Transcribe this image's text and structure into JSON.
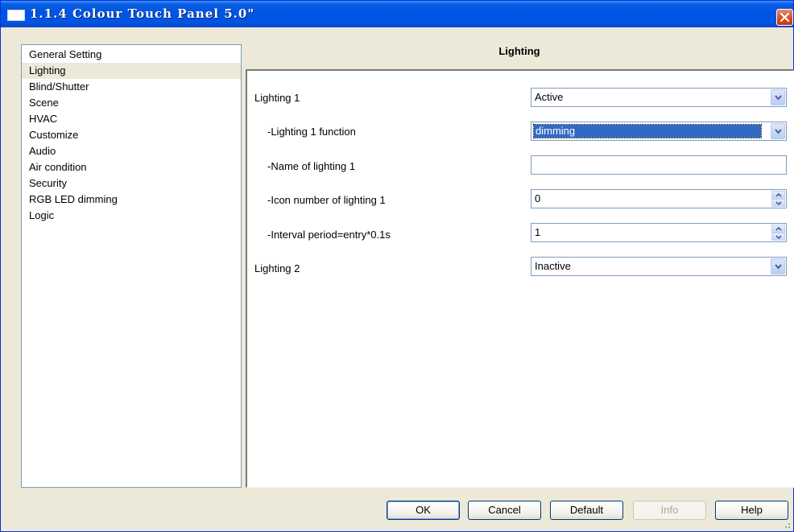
{
  "window": {
    "title": "1.1.4 Colour Touch Panel 5.0\"",
    "close_icon": "close-icon"
  },
  "nav": {
    "items": [
      {
        "label": "General Setting",
        "selected": false
      },
      {
        "label": "Lighting",
        "selected": true
      },
      {
        "label": "Blind/Shutter",
        "selected": false
      },
      {
        "label": "Scene",
        "selected": false
      },
      {
        "label": "HVAC",
        "selected": false
      },
      {
        "label": "Customize",
        "selected": false
      },
      {
        "label": "Audio",
        "selected": false
      },
      {
        "label": "Air condition",
        "selected": false
      },
      {
        "label": "Security",
        "selected": false
      },
      {
        "label": "RGB LED dimming",
        "selected": false
      },
      {
        "label": "Logic",
        "selected": false
      }
    ]
  },
  "section": {
    "title": "Lighting"
  },
  "params": {
    "lighting1": {
      "label": "Lighting 1",
      "value": "Active"
    },
    "lighting1_function": {
      "label": "-Lighting 1 function",
      "value": "dimming"
    },
    "name_of_lighting1": {
      "label": "-Name of lighting 1",
      "value": ""
    },
    "icon_number_lighting1": {
      "label": "-Icon number of lighting 1",
      "value": "0"
    },
    "interval_period": {
      "label": "-Interval period=entry*0.1s",
      "value": "1"
    },
    "lighting2": {
      "label": "Lighting 2",
      "value": "Inactive"
    }
  },
  "buttons": {
    "ok": "OK",
    "cancel": "Cancel",
    "default": "Default",
    "info": "Info",
    "help": "Help"
  },
  "colors": {
    "titlebar": "#0054e3",
    "window_bg": "#ece9d8",
    "selection": "#316ac5",
    "close_button": "#d44a1c"
  }
}
